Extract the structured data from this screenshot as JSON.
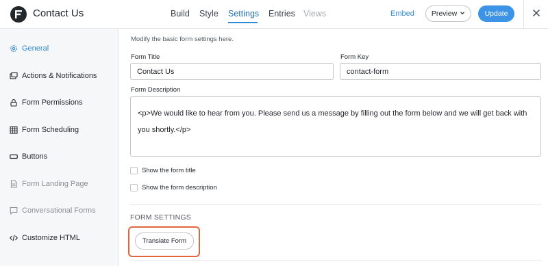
{
  "header": {
    "title": "Contact Us",
    "tabs": [
      {
        "label": "Build",
        "state": "normal"
      },
      {
        "label": "Style",
        "state": "normal"
      },
      {
        "label": "Settings",
        "state": "active"
      },
      {
        "label": "Entries",
        "state": "normal"
      },
      {
        "label": "Views",
        "state": "disabled"
      }
    ],
    "embed_label": "Embed",
    "preview_label": "Preview",
    "update_label": "Update",
    "close_icon": "close-icon"
  },
  "sidebar": {
    "items": [
      {
        "label": "General",
        "icon": "gear-icon",
        "state": "active"
      },
      {
        "label": "Actions & Notifications",
        "icon": "notifications-icon",
        "state": "normal"
      },
      {
        "label": "Form Permissions",
        "icon": "lock-icon",
        "state": "normal"
      },
      {
        "label": "Form Scheduling",
        "icon": "calendar-icon",
        "state": "normal"
      },
      {
        "label": "Buttons",
        "icon": "button-icon",
        "state": "normal"
      },
      {
        "label": "Form Landing Page",
        "icon": "page-icon",
        "state": "muted"
      },
      {
        "label": "Conversational Forms",
        "icon": "chat-icon",
        "state": "muted"
      },
      {
        "label": "Customize HTML",
        "icon": "code-icon",
        "state": "normal"
      }
    ]
  },
  "main": {
    "intro": "Modify the basic form settings here.",
    "form_title_label": "Form Title",
    "form_title_value": "Contact Us",
    "form_key_label": "Form Key",
    "form_key_value": "contact-form",
    "form_description_label": "Form Description",
    "form_description_value": "<p>We would like to hear from you. Please send us a message by filling out the form below and we will get back with you shortly.</p>",
    "show_title_label": "Show the form title",
    "show_description_label": "Show the form description",
    "section_heading": "FORM SETTINGS",
    "translate_label": "Translate Form"
  },
  "colors": {
    "accent": "#2e89d8",
    "update_button": "#3d93e6",
    "highlight_border": "#e2643a"
  }
}
